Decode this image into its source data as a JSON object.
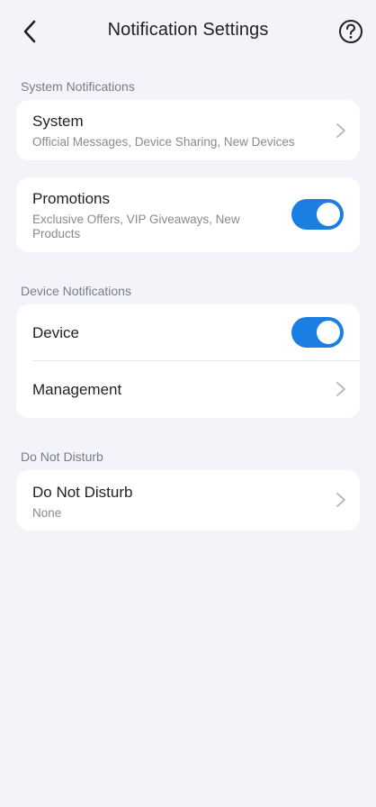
{
  "header": {
    "title": "Notification Settings",
    "back_icon": "chevron-left-icon",
    "help_icon": "question-circle-icon"
  },
  "sections": {
    "system": {
      "label": "System Notifications"
    },
    "device": {
      "label": "Device Notifications"
    },
    "dnd": {
      "label": "Do Not Disturb"
    }
  },
  "system_row": {
    "title": "System",
    "subtitle": "Official Messages, Device Sharing, New Devices"
  },
  "promotions_row": {
    "title": "Promotions",
    "subtitle": "Exclusive Offers, VIP Giveaways, New Products",
    "enabled": true
  },
  "device_row": {
    "title": "Device",
    "enabled": true
  },
  "management_row": {
    "title": "Management"
  },
  "dnd_row": {
    "title": "Do Not Disturb",
    "subtitle": "None"
  },
  "colors": {
    "background": "#f3f4f9",
    "card": "#ffffff",
    "toggle_on": "#1a7fe0",
    "secondary_text": "#888a92"
  }
}
